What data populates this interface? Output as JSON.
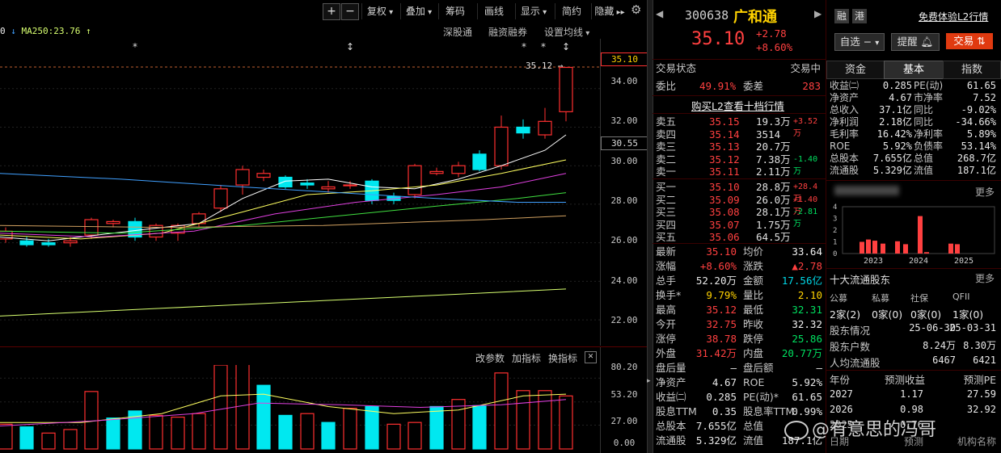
{
  "toolbar": {
    "plus": "+",
    "minus": "−",
    "adjust": "复权",
    "overlay": "叠加",
    "chips": "筹码",
    "draw": "画线",
    "display": "显示",
    "summary": "简约",
    "hide": "隐藏"
  },
  "chart_header": {
    "ma_prefix": "0",
    "ma250": "MA250:23.76",
    "links": [
      "深股通",
      "融资融券",
      "设置均线"
    ]
  },
  "price_axis": [
    "34.00",
    "32.00",
    "30.00",
    "28.00",
    "26.00",
    "24.00",
    "22.00"
  ],
  "price_axis_current": "35.10",
  "price_axis_tag": "30.55",
  "high_marker": "35.12",
  "vol_header": {
    "param": "改参数",
    "add": "加指标",
    "switch": "换指标",
    "close": "✕"
  },
  "vol_axis": [
    "80.20",
    "53.20",
    "27.00",
    "0.00"
  ],
  "stock": {
    "code": "300638",
    "name": "广和通",
    "price": "35.10",
    "change": "+2.78",
    "pct": "+8.60%",
    "tag_margin": "融",
    "tag_hk": "港",
    "l2_link": "免费体验L2行情",
    "watch": "自选",
    "remind": "提醒",
    "trade": "交易"
  },
  "order_book": {
    "status_label": "交易状态",
    "status_value": "交易中",
    "ratio_label": "委比",
    "ratio_value": "49.91%",
    "diff_label": "委差",
    "diff_value": "283",
    "buy_l2": "购买L2查看十档行情",
    "sells": [
      {
        "label": "卖五",
        "price": "35.15",
        "vol": "19.3万",
        "chg": "+3.52万"
      },
      {
        "label": "卖四",
        "price": "35.14",
        "vol": "3514",
        "chg": ""
      },
      {
        "label": "卖三",
        "price": "35.13",
        "vol": "20.7万",
        "chg": ""
      },
      {
        "label": "卖二",
        "price": "35.12",
        "vol": "7.38万",
        "chg": "-1.40万"
      },
      {
        "label": "卖一",
        "price": "35.11",
        "vol": "2.11万",
        "chg": ""
      }
    ],
    "buys": [
      {
        "label": "买一",
        "price": "35.10",
        "vol": "28.8万",
        "chg": "+28.4万"
      },
      {
        "label": "买二",
        "price": "35.09",
        "vol": "26.0万",
        "chg": "+1.40万"
      },
      {
        "label": "买三",
        "price": "35.08",
        "vol": "28.1万",
        "chg": "-2.81万"
      },
      {
        "label": "买四",
        "price": "35.07",
        "vol": "1.75万",
        "chg": ""
      },
      {
        "label": "买五",
        "price": "35.06",
        "vol": "64.5万",
        "chg": ""
      }
    ]
  },
  "quote": [
    {
      "l1": "最新",
      "v1": "35.10",
      "l2": "均价",
      "v2": "33.64"
    },
    {
      "l1": "涨幅",
      "v1": "+8.60%",
      "l2": "涨跌",
      "v2": "▲2.78"
    },
    {
      "l1": "总手",
      "v1": "52.20万",
      "l2": "金额",
      "v2": "17.56亿"
    },
    {
      "l1": "换手*",
      "v1": "9.79%",
      "l2": "量比",
      "v2": "2.10"
    },
    {
      "l1": "最高",
      "v1": "35.12",
      "l2": "最低",
      "v2": "32.31"
    },
    {
      "l1": "今开",
      "v1": "32.75",
      "l2": "昨收",
      "v2": "32.32"
    },
    {
      "l1": "涨停",
      "v1": "38.78",
      "l2": "跌停",
      "v2": "25.86"
    },
    {
      "l1": "外盘",
      "v1": "31.42万",
      "l2": "内盘",
      "v2": "20.77万"
    },
    {
      "l1": "盘后量",
      "v1": "—",
      "l2": "盘后额",
      "v2": "—"
    },
    {
      "l1": "净资产",
      "v1": "4.67",
      "l2": "ROE",
      "v2": "5.92%"
    },
    {
      "l1": "收益㈡",
      "v1": "0.285",
      "l2": "PE(动)*",
      "v2": "61.65"
    },
    {
      "l1": "股息TTM",
      "v1": "0.35",
      "l2": "股息率TTM",
      "v2": "0.99%"
    },
    {
      "l1": "总股本",
      "v1": "7.655亿",
      "l2": "总值",
      "v2": ""
    },
    {
      "l1": "流通股",
      "v1": "5.329亿",
      "l2": "流值",
      "v2": "187.1亿"
    }
  ],
  "tabs": [
    "资金",
    "基本",
    "指数"
  ],
  "fundamentals": [
    {
      "l1": "收益㈡",
      "v1": "0.285",
      "l2": "PE(动)",
      "v2": "61.65"
    },
    {
      "l1": "净资产",
      "v1": "4.67",
      "l2": "市净率",
      "v2": "7.52"
    },
    {
      "l1": "总收入",
      "v1": "37.1亿",
      "l2": "同比",
      "v2": "-9.02%"
    },
    {
      "l1": "净利润",
      "v1": "2.18亿",
      "l2": "同比",
      "v2": "-34.66%"
    },
    {
      "l1": "毛利率",
      "v1": "16.42%",
      "l2": "净利率",
      "v2": "5.89%"
    },
    {
      "l1": "ROE",
      "v1": "5.92%",
      "l2": "负债率",
      "v2": "53.14%"
    },
    {
      "l1": "总股本",
      "v1": "7.655亿",
      "l2": "总值",
      "v2": "268.7亿"
    },
    {
      "l1": "流通股",
      "v1": "5.329亿",
      "l2": "流值",
      "v2": "187.1亿"
    }
  ],
  "more": "更多",
  "mini_chart": {
    "y_ticks": [
      "4",
      "3",
      "2",
      "1",
      "0"
    ],
    "years": [
      "2023",
      "2024",
      "2025"
    ],
    "values": [
      1.0,
      1.2,
      1.1,
      0.85,
      1.05,
      0.8,
      3.2,
      0.12,
      0.85,
      0.8
    ]
  },
  "holders": {
    "title": "十大流通股东",
    "categories": [
      "公募",
      "私募",
      "社保",
      "QFII"
    ],
    "counts": [
      "2家(2)",
      "0家(0)",
      "0家(0)",
      "1家(0)"
    ],
    "info_label": "股东情况",
    "date1": "25-06-30",
    "date2": "25-03-31",
    "households_label": "股东户数",
    "households1": "8.24万",
    "households2": "8.30万",
    "per_capita_label": "人均流通股",
    "per_capita1": "6467",
    "per_capita2": "6421"
  },
  "forecast": {
    "headers": [
      "年份",
      "预测收益",
      "预测PE"
    ],
    "rows": [
      {
        "year": "2027",
        "eps": "1.17",
        "pe": "27.59"
      },
      {
        "year": "2026",
        "eps": "0.98",
        "pe": "32.92"
      },
      {
        "year": "2025",
        "eps": "0.76",
        "pe": ""
      }
    ],
    "footer": [
      "日期",
      "预测",
      "机构名称"
    ]
  },
  "watermark": "@有意思的冯哥",
  "colors": {
    "up": "#ff3030",
    "down": "#00e8f0",
    "ma5": "#ffffff",
    "ma10": "#ffff60",
    "ma20": "#e040e0",
    "ma30": "#40e040",
    "ma60": "#40a0ff",
    "ma250": "#d8ff70"
  }
}
